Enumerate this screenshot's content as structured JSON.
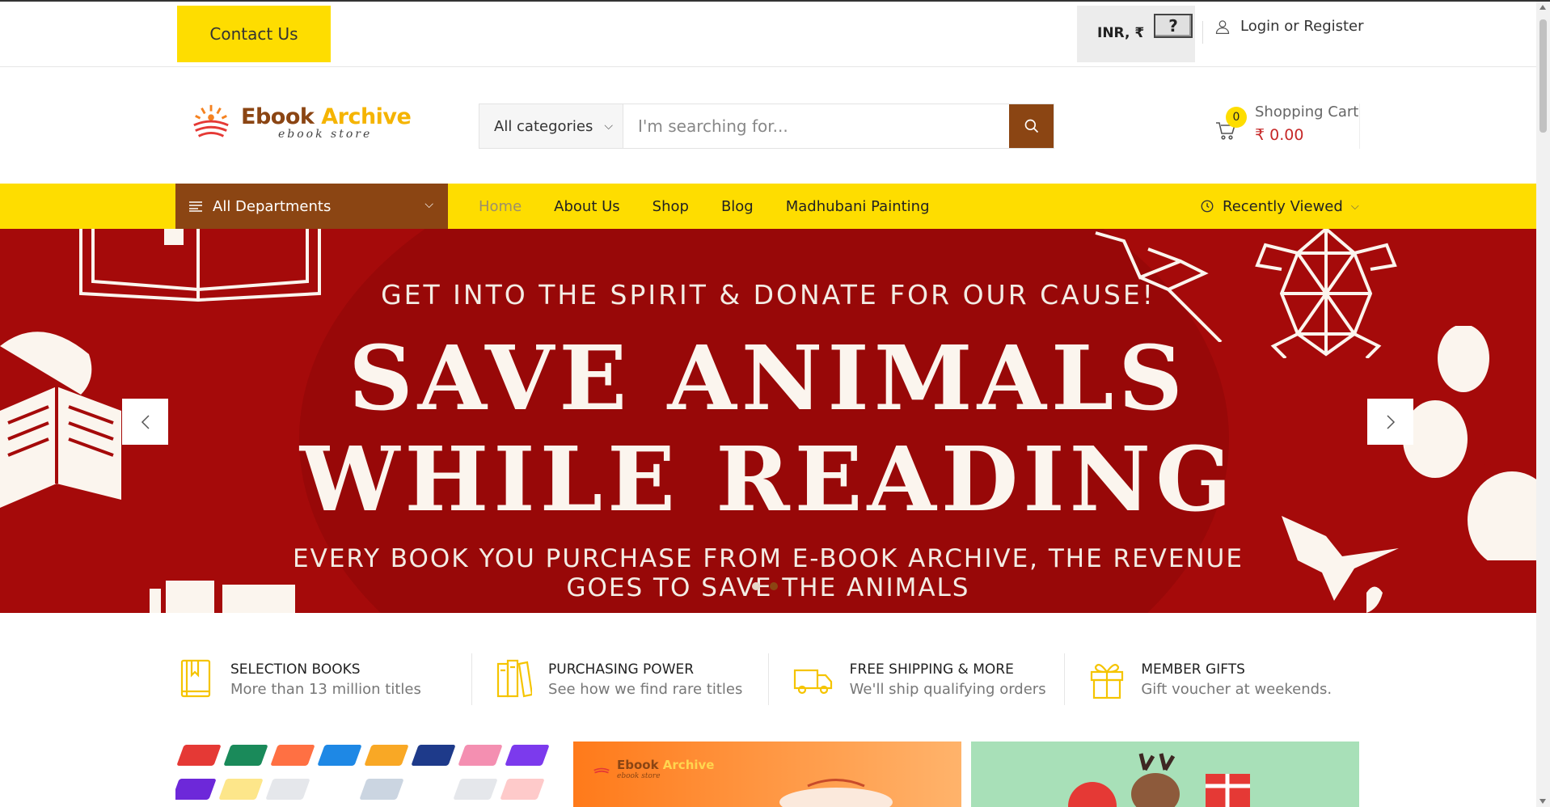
{
  "topbar": {
    "contact_label": "Contact Us",
    "currency_label": "INR, ₹",
    "help_glyph": "?",
    "login_label": "Login or Register",
    "login_icon": "user-icon"
  },
  "header": {
    "logo_part1": "Ebook ",
    "logo_part2": "Archive",
    "logo_tagline": "ebook store",
    "search_category": "All categories",
    "search_placeholder": "I'm searching for...",
    "search_icon": "search-icon",
    "cart_count": "0",
    "cart_label": "Shopping Cart",
    "cart_total": "₹ 0.00"
  },
  "nav": {
    "departments_label": "All Departments",
    "links": [
      "Home",
      "About Us",
      "Shop",
      "Blog",
      "Madhubani Painting"
    ],
    "active_link": "Home",
    "recent_label": "Recently Viewed"
  },
  "hero": {
    "kicker": "GET INTO THE SPIRIT & DONATE FOR OUR CAUSE!",
    "title_line1": "SAVE ANIMALS",
    "title_line2": "WHILE READING",
    "subtitle_line1": "EVERY BOOK YOU PURCHASE FROM  E-BOOK ARCHIVE, THE REVENUE",
    "subtitle_line2": "GOES TO SAVE THE ANIMALS",
    "slide_count": 2,
    "active_slide": 2
  },
  "features": [
    {
      "title": "SELECTION BOOKS",
      "subtitle": "More than 13 million titles",
      "icon": "book-icon"
    },
    {
      "title": "PURCHASING POWER",
      "subtitle": "See how we find rare titles",
      "icon": "books-shelf-icon"
    },
    {
      "title": "FREE SHIPPING & MORE",
      "subtitle": "We'll ship qualifying orders",
      "icon": "truck-icon"
    },
    {
      "title": "MEMBER GIFTS",
      "subtitle": "Gift voucher at weekends.",
      "icon": "gift-icon"
    }
  ],
  "promos": {
    "promo2_logo_part1": "Ebook ",
    "promo2_logo_part2": "Archive",
    "promo2_tagline": "ebook store"
  },
  "colors": {
    "accent_yellow": "#fedd00",
    "brand_brown": "#8b4513",
    "hero_red": "#a50a0a",
    "price_red": "#c62828"
  }
}
